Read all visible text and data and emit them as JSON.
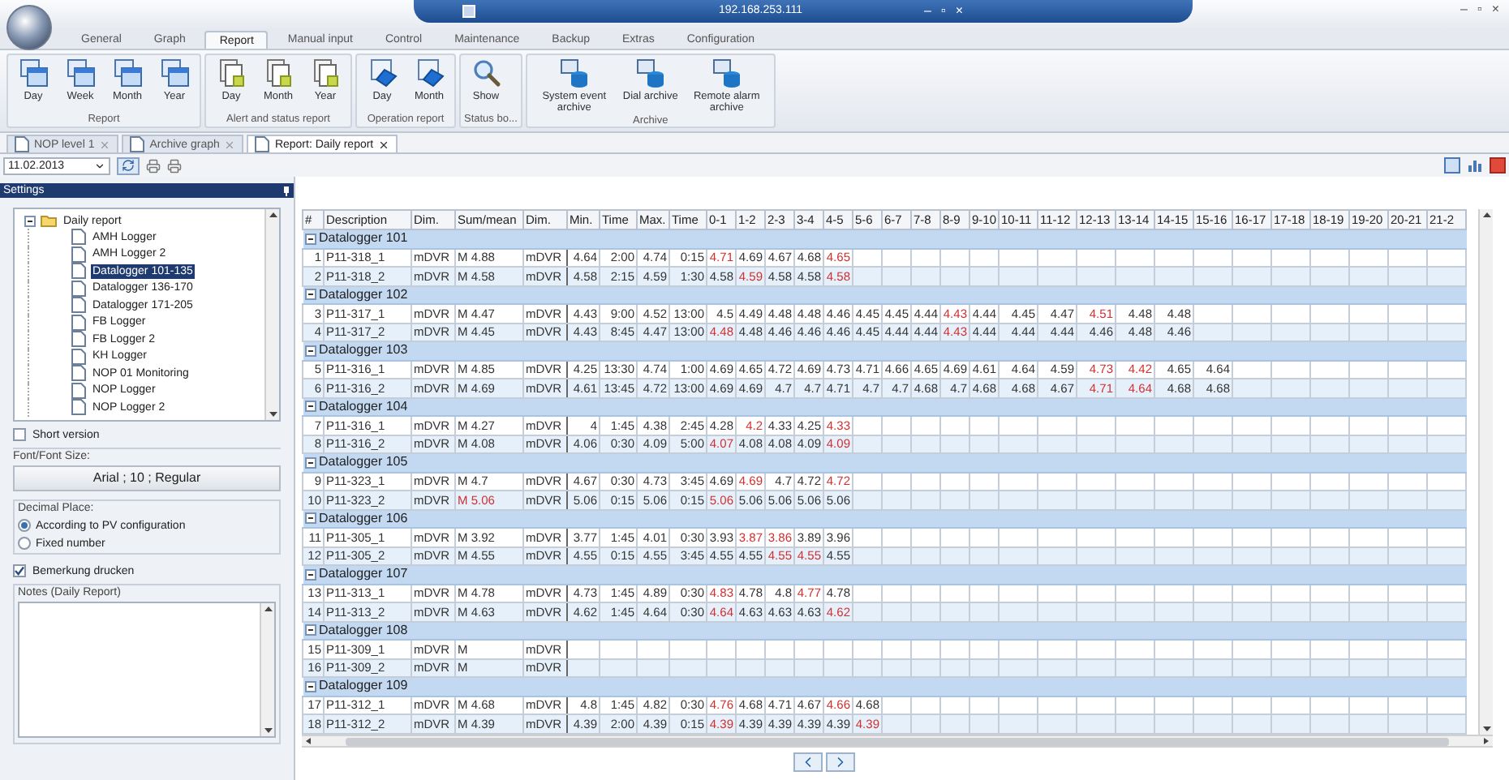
{
  "window": {
    "title": "192.168.253.111",
    "controls": [
      "–",
      "▫",
      "×"
    ],
    "outer_controls": [
      "–",
      "▫",
      "×"
    ]
  },
  "ribbon": {
    "tabs": [
      {
        "label": "General",
        "selected": false
      },
      {
        "label": "Graph",
        "selected": false
      },
      {
        "label": "Report",
        "selected": true
      },
      {
        "label": "Manual input",
        "selected": false
      },
      {
        "label": "Control",
        "selected": false
      },
      {
        "label": "Maintenance",
        "selected": false
      },
      {
        "label": "Backup",
        "selected": false
      },
      {
        "label": "Extras",
        "selected": false
      },
      {
        "label": "Configuration",
        "selected": false
      }
    ],
    "groups": [
      {
        "label": "Report",
        "kind": "window",
        "buttons": [
          "Day",
          "Week",
          "Month",
          "Year"
        ]
      },
      {
        "label": "Alert and status report",
        "kind": "sheet",
        "buttons": [
          "Day",
          "Month",
          "Year"
        ]
      },
      {
        "label": "Operation report",
        "kind": "operation",
        "buttons": [
          "Day",
          "Month"
        ]
      },
      {
        "label": "Status bo...",
        "kind": "search",
        "buttons": [
          "Show"
        ]
      },
      {
        "label": "Archive",
        "kind": "archive",
        "buttons": [
          "System event archive",
          "Dial archive",
          "Remote alarm archive"
        ]
      }
    ]
  },
  "doc_tabs": [
    {
      "label": "NOP level 1",
      "selected": false
    },
    {
      "label": "Archive graph",
      "selected": false
    },
    {
      "label": "Report: Daily report",
      "selected": true
    }
  ],
  "toolbar": {
    "date": "11.02.2013"
  },
  "settings": {
    "title": "Settings",
    "tree": [
      {
        "label": "Daily report",
        "expanded": true,
        "selected": false,
        "children": [
          {
            "label": "AMH Logger",
            "selected": false
          },
          {
            "label": "AMH Logger 2",
            "selected": false
          },
          {
            "label": "Datalogger 101-135",
            "selected": true
          },
          {
            "label": "Datalogger 136-170",
            "selected": false
          },
          {
            "label": "Datalogger 171-205",
            "selected": false
          },
          {
            "label": "FB Logger",
            "selected": false
          },
          {
            "label": "FB Logger 2",
            "selected": false
          },
          {
            "label": "KH Logger",
            "selected": false
          },
          {
            "label": "NOP 01 Monitoring",
            "selected": false
          },
          {
            "label": "NOP Logger",
            "selected": false
          },
          {
            "label": "NOP Logger 2",
            "selected": false
          }
        ]
      }
    ],
    "short_version": {
      "label": "Short version",
      "checked": false
    },
    "font": {
      "label": "Font/Font Size:",
      "value": "Arial ; 10 ; Regular"
    },
    "decimal": {
      "label": "Decimal Place:",
      "options": [
        {
          "label": "According to PV configuration",
          "selected": true
        },
        {
          "label": "Fixed number",
          "selected": false
        }
      ]
    },
    "print_notes": {
      "label": "Bemerkung drucken",
      "checked": true
    },
    "notes": {
      "label": "Notes (Daily Report)"
    }
  },
  "table": {
    "columns": [
      "#",
      "Description",
      "Dim.",
      "Sum/mean",
      "Dim.",
      "Min.",
      "Time",
      "Max.",
      "Time",
      "0-1",
      "1-2",
      "2-3",
      "3-4",
      "4-5",
      "5-6",
      "6-7",
      "7-8",
      "8-9",
      "9-10",
      "10-11",
      "11-12",
      "12-13",
      "13-14",
      "14-15",
      "15-16",
      "16-17",
      "17-18",
      "18-19",
      "19-20",
      "20-21",
      "21-2"
    ],
    "groups": [
      {
        "label": "Datalogger 101",
        "expanded": true,
        "rows": [
          {
            "cells": [
              "1",
              "P11-318_1",
              "mDVR",
              "M 4.88",
              "mDVR",
              "4.64",
              "2:00",
              "4.74",
              "0:15"
            ],
            "sum_alert": false,
            "hours": [
              {
                "v": "4.71",
                "alert": true
              },
              {
                "v": "4.69",
                "alert": false
              },
              {
                "v": "4.67",
                "alert": false
              },
              {
                "v": "4.68",
                "alert": false
              },
              {
                "v": "4.65",
                "alert": true
              }
            ]
          },
          {
            "cells": [
              "2",
              "P11-318_2",
              "mDVR",
              "M 4.58",
              "mDVR",
              "4.58",
              "2:15",
              "4.59",
              "1:30"
            ],
            "sum_alert": false,
            "hours": [
              {
                "v": "4.58",
                "alert": false
              },
              {
                "v": "4.59",
                "alert": true
              },
              {
                "v": "4.58",
                "alert": false
              },
              {
                "v": "4.58",
                "alert": false
              },
              {
                "v": "4.58",
                "alert": true
              }
            ]
          }
        ]
      },
      {
        "label": "Datalogger 102",
        "expanded": true,
        "rows": [
          {
            "cells": [
              "3",
              "P11-317_1",
              "mDVR",
              "M 4.47",
              "mDVR",
              "4.43",
              "9:00",
              "4.52",
              "13:00"
            ],
            "sum_alert": false,
            "hours": [
              {
                "v": "4.5",
                "alert": false
              },
              {
                "v": "4.49",
                "alert": false
              },
              {
                "v": "4.48",
                "alert": false
              },
              {
                "v": "4.48",
                "alert": false
              },
              {
                "v": "4.46",
                "alert": false
              },
              {
                "v": "4.45",
                "alert": false
              },
              {
                "v": "4.45",
                "alert": false
              },
              {
                "v": "4.44",
                "alert": false
              },
              {
                "v": "4.43",
                "alert": true
              },
              {
                "v": "4.44",
                "alert": false
              },
              {
                "v": "4.45",
                "alert": false
              },
              {
                "v": "4.47",
                "alert": false
              },
              {
                "v": "4.51",
                "alert": true
              },
              {
                "v": "4.48",
                "alert": false
              },
              {
                "v": "4.48",
                "alert": false
              }
            ]
          },
          {
            "cells": [
              "4",
              "P11-317_2",
              "mDVR",
              "M 4.45",
              "mDVR",
              "4.43",
              "8:45",
              "4.47",
              "13:00"
            ],
            "sum_alert": false,
            "hours": [
              {
                "v": "4.48",
                "alert": true
              },
              {
                "v": "4.48",
                "alert": false
              },
              {
                "v": "4.46",
                "alert": false
              },
              {
                "v": "4.46",
                "alert": false
              },
              {
                "v": "4.46",
                "alert": false
              },
              {
                "v": "4.45",
                "alert": false
              },
              {
                "v": "4.44",
                "alert": false
              },
              {
                "v": "4.44",
                "alert": false
              },
              {
                "v": "4.43",
                "alert": true
              },
              {
                "v": "4.44",
                "alert": false
              },
              {
                "v": "4.44",
                "alert": false
              },
              {
                "v": "4.44",
                "alert": false
              },
              {
                "v": "4.46",
                "alert": false
              },
              {
                "v": "4.48",
                "alert": false
              },
              {
                "v": "4.46",
                "alert": false
              }
            ]
          }
        ]
      },
      {
        "label": "Datalogger 103",
        "expanded": true,
        "rows": [
          {
            "cells": [
              "5",
              "P11-316_1",
              "mDVR",
              "M 4.85",
              "mDVR",
              "4.25",
              "13:30",
              "4.74",
              "1:00"
            ],
            "sum_alert": false,
            "hours": [
              {
                "v": "4.69",
                "alert": false
              },
              {
                "v": "4.65",
                "alert": false
              },
              {
                "v": "4.72",
                "alert": false
              },
              {
                "v": "4.69",
                "alert": false
              },
              {
                "v": "4.73",
                "alert": false
              },
              {
                "v": "4.71",
                "alert": false
              },
              {
                "v": "4.66",
                "alert": false
              },
              {
                "v": "4.65",
                "alert": false
              },
              {
                "v": "4.69",
                "alert": false
              },
              {
                "v": "4.61",
                "alert": false
              },
              {
                "v": "4.64",
                "alert": false
              },
              {
                "v": "4.59",
                "alert": false
              },
              {
                "v": "4.73",
                "alert": true
              },
              {
                "v": "4.42",
                "alert": true
              },
              {
                "v": "4.65",
                "alert": false
              },
              {
                "v": "4.64",
                "alert": false
              }
            ]
          },
          {
            "cells": [
              "6",
              "P11-316_2",
              "mDVR",
              "M 4.69",
              "mDVR",
              "4.61",
              "13:45",
              "4.72",
              "13:00"
            ],
            "sum_alert": false,
            "hours": [
              {
                "v": "4.69",
                "alert": false
              },
              {
                "v": "4.69",
                "alert": false
              },
              {
                "v": "4.7",
                "alert": false
              },
              {
                "v": "4.7",
                "alert": false
              },
              {
                "v": "4.71",
                "alert": false
              },
              {
                "v": "4.7",
                "alert": false
              },
              {
                "v": "4.7",
                "alert": false
              },
              {
                "v": "4.68",
                "alert": false
              },
              {
                "v": "4.7",
                "alert": false
              },
              {
                "v": "4.68",
                "alert": false
              },
              {
                "v": "4.68",
                "alert": false
              },
              {
                "v": "4.67",
                "alert": false
              },
              {
                "v": "4.71",
                "alert": true
              },
              {
                "v": "4.64",
                "alert": true
              },
              {
                "v": "4.68",
                "alert": false
              },
              {
                "v": "4.68",
                "alert": false
              }
            ]
          }
        ]
      },
      {
        "label": "Datalogger 104",
        "expanded": true,
        "rows": [
          {
            "cells": [
              "7",
              "P11-316_1",
              "mDVR",
              "M 4.27",
              "mDVR",
              "4",
              "1:45",
              "4.38",
              "2:45"
            ],
            "sum_alert": false,
            "hours": [
              {
                "v": "4.28",
                "alert": false
              },
              {
                "v": "4.2",
                "alert": true
              },
              {
                "v": "4.33",
                "alert": false
              },
              {
                "v": "4.25",
                "alert": false
              },
              {
                "v": "4.33",
                "alert": true
              }
            ]
          },
          {
            "cells": [
              "8",
              "P11-316_2",
              "mDVR",
              "M 4.08",
              "mDVR",
              "4.06",
              "0:30",
              "4.09",
              "5:00"
            ],
            "sum_alert": false,
            "hours": [
              {
                "v": "4.07",
                "alert": true
              },
              {
                "v": "4.08",
                "alert": false
              },
              {
                "v": "4.08",
                "alert": false
              },
              {
                "v": "4.09",
                "alert": false
              },
              {
                "v": "4.09",
                "alert": true
              }
            ]
          }
        ]
      },
      {
        "label": "Datalogger 105",
        "expanded": true,
        "rows": [
          {
            "cells": [
              "9",
              "P11-323_1",
              "mDVR",
              "M 4.7",
              "mDVR",
              "4.67",
              "0:30",
              "4.73",
              "3:45"
            ],
            "sum_alert": false,
            "hours": [
              {
                "v": "4.69",
                "alert": false
              },
              {
                "v": "4.69",
                "alert": true
              },
              {
                "v": "4.7",
                "alert": false
              },
              {
                "v": "4.72",
                "alert": false
              },
              {
                "v": "4.72",
                "alert": true
              }
            ]
          },
          {
            "cells": [
              "10",
              "P11-323_2",
              "mDVR",
              "M 5.06",
              "mDVR",
              "5.06",
              "0:15",
              "5.06",
              "0:15"
            ],
            "sum_alert": true,
            "hours": [
              {
                "v": "5.06",
                "alert": true
              },
              {
                "v": "5.06",
                "alert": false
              },
              {
                "v": "5.06",
                "alert": false
              },
              {
                "v": "5.06",
                "alert": false
              },
              {
                "v": "5.06",
                "alert": false
              }
            ]
          }
        ]
      },
      {
        "label": "Datalogger 106",
        "expanded": true,
        "rows": [
          {
            "cells": [
              "11",
              "P11-305_1",
              "mDVR",
              "M 3.92",
              "mDVR",
              "3.77",
              "1:45",
              "4.01",
              "0:30"
            ],
            "sum_alert": false,
            "hours": [
              {
                "v": "3.93",
                "alert": false
              },
              {
                "v": "3.87",
                "alert": true
              },
              {
                "v": "3.86",
                "alert": true
              },
              {
                "v": "3.89",
                "alert": false
              },
              {
                "v": "3.96",
                "alert": false
              }
            ]
          },
          {
            "cells": [
              "12",
              "P11-305_2",
              "mDVR",
              "M 4.55",
              "mDVR",
              "4.55",
              "0:15",
              "4.55",
              "3:45"
            ],
            "sum_alert": false,
            "hours": [
              {
                "v": "4.55",
                "alert": false
              },
              {
                "v": "4.55",
                "alert": false
              },
              {
                "v": "4.55",
                "alert": true
              },
              {
                "v": "4.55",
                "alert": true
              },
              {
                "v": "4.55",
                "alert": false
              }
            ]
          }
        ]
      },
      {
        "label": "Datalogger 107",
        "expanded": true,
        "rows": [
          {
            "cells": [
              "13",
              "P11-313_1",
              "mDVR",
              "M 4.78",
              "mDVR",
              "4.73",
              "1:45",
              "4.89",
              "0:30"
            ],
            "sum_alert": false,
            "hours": [
              {
                "v": "4.83",
                "alert": true
              },
              {
                "v": "4.78",
                "alert": false
              },
              {
                "v": "4.8",
                "alert": false
              },
              {
                "v": "4.77",
                "alert": true
              },
              {
                "v": "4.78",
                "alert": false
              }
            ]
          },
          {
            "cells": [
              "14",
              "P11-313_2",
              "mDVR",
              "M 4.63",
              "mDVR",
              "4.62",
              "1:45",
              "4.64",
              "0:30"
            ],
            "sum_alert": false,
            "hours": [
              {
                "v": "4.64",
                "alert": true
              },
              {
                "v": "4.63",
                "alert": false
              },
              {
                "v": "4.63",
                "alert": false
              },
              {
                "v": "4.63",
                "alert": false
              },
              {
                "v": "4.62",
                "alert": true
              }
            ]
          }
        ]
      },
      {
        "label": "Datalogger 108",
        "expanded": true,
        "rows": [
          {
            "cells": [
              "15",
              "P11-309_1",
              "mDVR",
              "M",
              "mDVR"
            ],
            "sum_alert": false,
            "hours": []
          },
          {
            "cells": [
              "16",
              "P11-309_2",
              "mDVR",
              "M",
              "mDVR"
            ],
            "sum_alert": false,
            "hours": []
          }
        ]
      },
      {
        "label": "Datalogger 109",
        "expanded": true,
        "rows": [
          {
            "cells": [
              "17",
              "P11-312_1",
              "mDVR",
              "M 4.68",
              "mDVR",
              "4.8",
              "1:45",
              "4.82",
              "0:30"
            ],
            "sum_alert": false,
            "hours": [
              {
                "v": "4.76",
                "alert": true
              },
              {
                "v": "4.68",
                "alert": false
              },
              {
                "v": "4.71",
                "alert": false
              },
              {
                "v": "4.67",
                "alert": false
              },
              {
                "v": "4.66",
                "alert": true
              },
              {
                "v": "4.68",
                "alert": false
              }
            ]
          },
          {
            "cells": [
              "18",
              "P11-312_2",
              "mDVR",
              "M 4.39",
              "mDVR",
              "4.39",
              "2:00",
              "4.39",
              "0:15"
            ],
            "sum_alert": false,
            "hours": [
              {
                "v": "4.39",
                "alert": true
              },
              {
                "v": "4.39",
                "alert": false
              },
              {
                "v": "4.39",
                "alert": false
              },
              {
                "v": "4.39",
                "alert": false
              },
              {
                "v": "4.39",
                "alert": false
              },
              {
                "v": "4.39",
                "alert": true
              }
            ]
          }
        ]
      }
    ]
  }
}
